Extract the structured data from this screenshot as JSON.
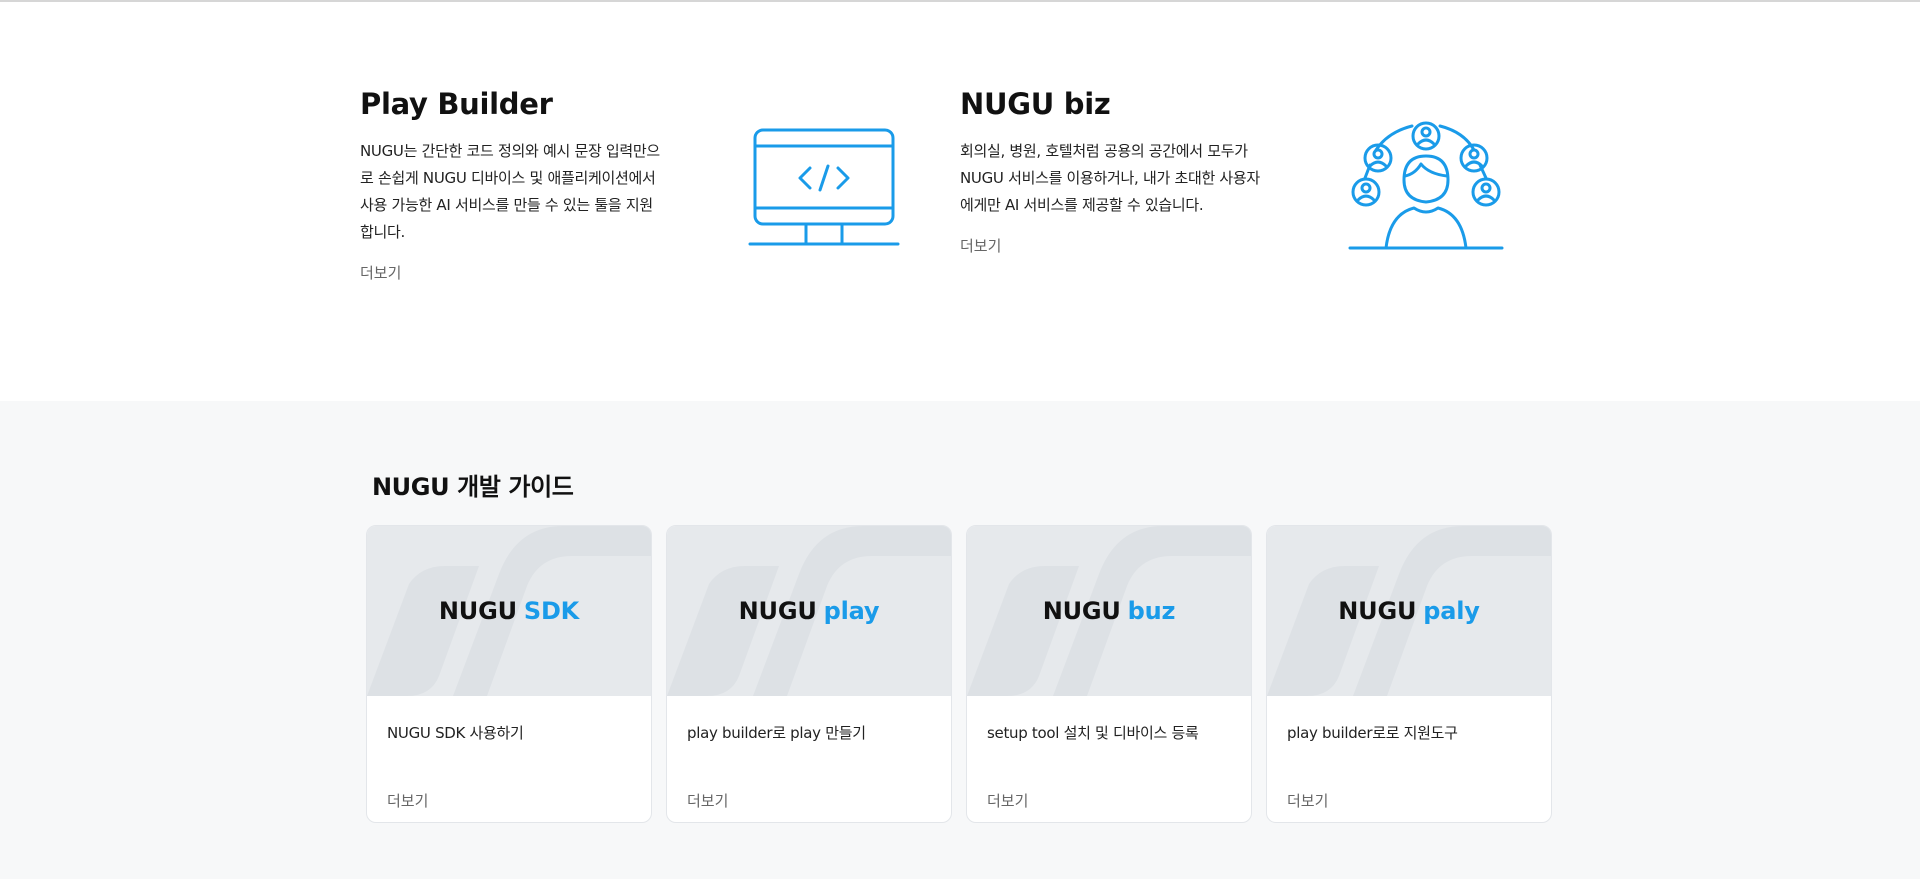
{
  "features": [
    {
      "title": "Play Builder",
      "description": "NUGU는 간단한 코드 정의와 예시 문장 입력만으로 손쉽게 NUGU 디바이스 및 애플리케이션에서 사용 가능한 AI 서비스를 만들 수 있는 툴을 지원합니다.",
      "more_label": "더보기",
      "icon": "monitor-code-icon"
    },
    {
      "title": "NUGU biz",
      "description": "회의실, 병원, 호텔처럼 공용의 공간에서 모두가 NUGU 서비스를 이용하거나, 내가 초대한 사용자에게만 AI 서비스를 제공할 수 있습니다.",
      "more_label": "더보기",
      "icon": "user-network-icon"
    }
  ],
  "guide": {
    "title": "NUGU 개발 가이드",
    "cards": [
      {
        "brand": "NUGU",
        "brand_accent": "SDK",
        "description": "NUGU SDK 사용하기",
        "more_label": "더보기"
      },
      {
        "brand": "NUGU",
        "brand_accent": "play",
        "description": "play builder로 play 만들기",
        "more_label": "더보기"
      },
      {
        "brand": "NUGU",
        "brand_accent": "buz",
        "description": "setup tool 설치 및 디바이스 등록",
        "more_label": "더보기"
      },
      {
        "brand": "NUGU",
        "brand_accent": "paly",
        "description": "play builder로로 지원도구",
        "more_label": "더보기"
      }
    ]
  },
  "colors": {
    "accent": "#1a9be9",
    "guide_background": "#f7f8f9",
    "card_thumb": "#e6e9ec"
  }
}
